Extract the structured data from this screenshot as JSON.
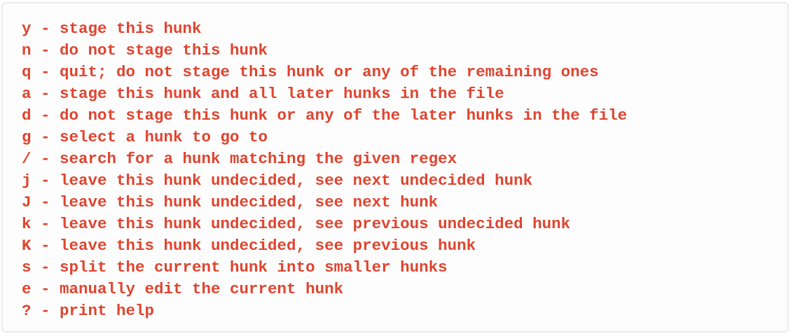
{
  "help_lines": [
    "y - stage this hunk",
    "n - do not stage this hunk",
    "q - quit; do not stage this hunk or any of the remaining ones",
    "a - stage this hunk and all later hunks in the file",
    "d - do not stage this hunk or any of the later hunks in the file",
    "g - select a hunk to go to",
    "/ - search for a hunk matching the given regex",
    "j - leave this hunk undecided, see next undecided hunk",
    "J - leave this hunk undecided, see next hunk",
    "k - leave this hunk undecided, see previous undecided hunk",
    "K - leave this hunk undecided, see previous hunk",
    "s - split the current hunk into smaller hunks",
    "e - manually edit the current hunk",
    "? - print help"
  ],
  "colors": {
    "text": "#e0442f",
    "panel_background": "#fdfdfd",
    "panel_border": "#ebebeb"
  }
}
